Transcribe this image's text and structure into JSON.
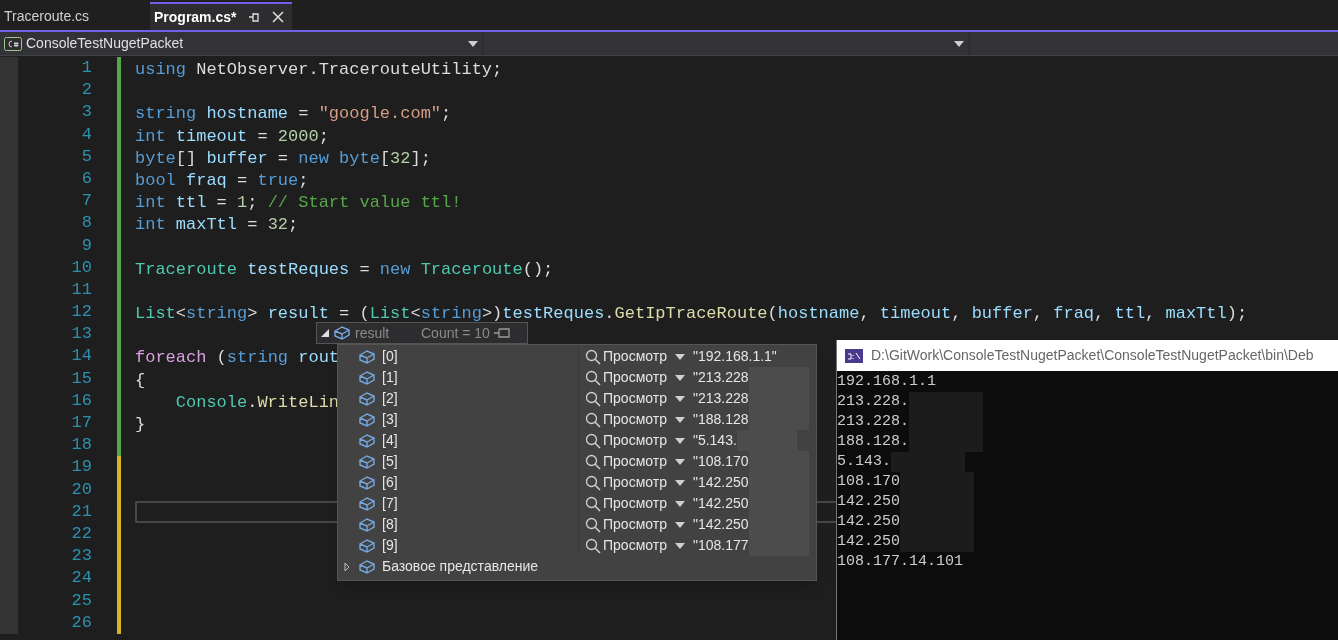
{
  "tabs": [
    {
      "label": "Traceroute.cs",
      "selected": false
    },
    {
      "label": "Program.cs*",
      "selected": true
    }
  ],
  "nav_bar": {
    "project": "ConsoleTestNugetPacket"
  },
  "editor": {
    "lines": [
      {
        "number": "1",
        "modified": false,
        "tokens": [
          {
            "text": "using ",
            "kind": "keyword"
          },
          {
            "text": "NetObserver.TracerouteUtility;",
            "kind": "plain"
          }
        ]
      },
      {
        "number": "2",
        "modified": false
      },
      {
        "number": "3",
        "modified": false,
        "tokens": [
          {
            "text": "string ",
            "kind": "keyword"
          },
          {
            "text": "hostname",
            "kind": "var"
          },
          {
            "text": " = ",
            "kind": "plain"
          },
          {
            "text": "\"google.com\"",
            "kind": "string"
          },
          {
            "text": ";",
            "kind": "plain"
          }
        ]
      },
      {
        "number": "4",
        "modified": false,
        "tokens": [
          {
            "text": "int ",
            "kind": "keyword"
          },
          {
            "text": "timeout",
            "kind": "var"
          },
          {
            "text": " = ",
            "kind": "plain"
          },
          {
            "text": "2000",
            "kind": "number"
          },
          {
            "text": ";",
            "kind": "plain"
          }
        ]
      },
      {
        "number": "5",
        "modified": false,
        "tokens": [
          {
            "text": "byte",
            "kind": "keyword"
          },
          {
            "text": "[] ",
            "kind": "plain"
          },
          {
            "text": "buffer",
            "kind": "var"
          },
          {
            "text": " = ",
            "kind": "plain"
          },
          {
            "text": "new ",
            "kind": "keyword"
          },
          {
            "text": "byte",
            "kind": "keyword"
          },
          {
            "text": "[",
            "kind": "plain"
          },
          {
            "text": "32",
            "kind": "number"
          },
          {
            "text": "];",
            "kind": "plain"
          }
        ]
      },
      {
        "number": "6",
        "modified": false,
        "tokens": [
          {
            "text": "bool ",
            "kind": "keyword"
          },
          {
            "text": "fraq",
            "kind": "var"
          },
          {
            "text": " = ",
            "kind": "plain"
          },
          {
            "text": "true",
            "kind": "keyword"
          },
          {
            "text": ";",
            "kind": "plain"
          }
        ]
      },
      {
        "number": "7",
        "modified": false,
        "tokens": [
          {
            "text": "int ",
            "kind": "keyword"
          },
          {
            "text": "ttl",
            "kind": "var"
          },
          {
            "text": " = ",
            "kind": "plain"
          },
          {
            "text": "1",
            "kind": "number"
          },
          {
            "text": "; ",
            "kind": "plain"
          },
          {
            "text": "// Start value ttl!",
            "kind": "comment"
          }
        ]
      },
      {
        "number": "8",
        "modified": false,
        "tokens": [
          {
            "text": "int ",
            "kind": "keyword"
          },
          {
            "text": "maxTtl",
            "kind": "var"
          },
          {
            "text": " = ",
            "kind": "plain"
          },
          {
            "text": "32",
            "kind": "number"
          },
          {
            "text": ";",
            "kind": "plain"
          }
        ]
      },
      {
        "number": "9",
        "modified": false
      },
      {
        "number": "10",
        "modified": false,
        "tokens": [
          {
            "text": "Traceroute ",
            "kind": "type"
          },
          {
            "text": "testReques",
            "kind": "var"
          },
          {
            "text": " = ",
            "kind": "plain"
          },
          {
            "text": "new ",
            "kind": "keyword"
          },
          {
            "text": "Traceroute",
            "kind": "type"
          },
          {
            "text": "();",
            "kind": "plain"
          }
        ]
      },
      {
        "number": "11",
        "modified": false
      },
      {
        "number": "12",
        "modified": false,
        "tokens": [
          {
            "text": "List",
            "kind": "type"
          },
          {
            "text": "<",
            "kind": "plain"
          },
          {
            "text": "string",
            "kind": "keyword"
          },
          {
            "text": "> ",
            "kind": "plain"
          },
          {
            "text": "result",
            "kind": "var"
          },
          {
            "text": " = (",
            "kind": "plain"
          },
          {
            "text": "List",
            "kind": "type"
          },
          {
            "text": "<",
            "kind": "plain"
          },
          {
            "text": "string",
            "kind": "keyword"
          },
          {
            "text": ">)",
            "kind": "plain"
          },
          {
            "text": "testReques",
            "kind": "var"
          },
          {
            "text": ".",
            "kind": "plain"
          },
          {
            "text": "GetIpTraceRoute",
            "kind": "method"
          },
          {
            "text": "(",
            "kind": "plain"
          },
          {
            "text": "hostname",
            "kind": "var"
          },
          {
            "text": ", ",
            "kind": "plain"
          },
          {
            "text": "timeout",
            "kind": "var"
          },
          {
            "text": ", ",
            "kind": "plain"
          },
          {
            "text": "buffer",
            "kind": "var"
          },
          {
            "text": ", ",
            "kind": "plain"
          },
          {
            "text": "fraq",
            "kind": "var"
          },
          {
            "text": ", ",
            "kind": "plain"
          },
          {
            "text": "ttl",
            "kind": "var"
          },
          {
            "text": ", ",
            "kind": "plain"
          },
          {
            "text": "maxTtl",
            "kind": "var"
          },
          {
            "text": ");",
            "kind": "plain"
          }
        ]
      },
      {
        "number": "13",
        "modified": false
      },
      {
        "number": "14",
        "modified": false,
        "tokens": [
          {
            "text": "foreach",
            "kind": "control"
          },
          {
            "text": " (",
            "kind": "plain"
          },
          {
            "text": "string ",
            "kind": "keyword"
          },
          {
            "text": "rout",
            "kind": "var"
          }
        ]
      },
      {
        "number": "15",
        "modified": false,
        "tokens": [
          {
            "text": "{",
            "kind": "plain"
          }
        ]
      },
      {
        "number": "16",
        "modified": false,
        "tokens": [
          {
            "text": "    Console",
            "kind": "type"
          },
          {
            "text": ".",
            "kind": "plain"
          },
          {
            "text": "WriteLin",
            "kind": "method"
          }
        ]
      },
      {
        "number": "17",
        "modified": false,
        "tokens": [
          {
            "text": "}",
            "kind": "plain"
          }
        ]
      },
      {
        "number": "18",
        "modified": false
      },
      {
        "number": "19",
        "modified": true
      },
      {
        "number": "20",
        "modified": true
      },
      {
        "number": "21",
        "modified": true,
        "current": true
      },
      {
        "number": "22",
        "modified": true
      },
      {
        "number": "23",
        "modified": true
      },
      {
        "number": "24",
        "modified": true
      },
      {
        "number": "25",
        "modified": true
      },
      {
        "number": "26",
        "modified": true
      }
    ]
  },
  "datatip": {
    "name": "result",
    "count": "Count = 10",
    "items": [
      {
        "index": "[0]",
        "viewer": "Просмотр",
        "value": "\"192.168.1.1\"",
        "redacted": false
      },
      {
        "index": "[1]",
        "viewer": "Просмотр",
        "value": "\"213.228",
        "redacted": true
      },
      {
        "index": "[2]",
        "viewer": "Просмотр",
        "value": "\"213.228",
        "redacted": true
      },
      {
        "index": "[3]",
        "viewer": "Просмотр",
        "value": "\"188.128",
        "redacted": true
      },
      {
        "index": "[4]",
        "viewer": "Просмотр",
        "value": "\"5.143.",
        "redacted": true
      },
      {
        "index": "[5]",
        "viewer": "Просмотр",
        "value": "\"108.170",
        "redacted": true
      },
      {
        "index": "[6]",
        "viewer": "Просмотр",
        "value": "\"142.250",
        "redacted": true
      },
      {
        "index": "[7]",
        "viewer": "Просмотр",
        "value": "\"142.250",
        "redacted": true
      },
      {
        "index": "[8]",
        "viewer": "Просмотр",
        "value": "\"142.250",
        "redacted": true
      },
      {
        "index": "[9]",
        "viewer": "Просмотр",
        "value": "\"108.177",
        "redacted": true
      }
    ],
    "base": {
      "label": "Базовое представление",
      "expanded": false
    }
  },
  "console": {
    "title": "D:\\GitWork\\ConsoleTestNugetPacket\\ConsoleTestNugetPacket\\bin\\Deb",
    "lines": [
      {
        "text": "192.168.1.1",
        "redacted": false
      },
      {
        "text": "213.228.",
        "redacted": true
      },
      {
        "text": "213.228.",
        "redacted": true
      },
      {
        "text": "188.128.",
        "redacted": true
      },
      {
        "text": "5.143.",
        "redacted": true
      },
      {
        "text": "108.170",
        "redacted": true
      },
      {
        "text": "142.250",
        "redacted": true
      },
      {
        "text": "142.250",
        "redacted": true
      },
      {
        "text": "142.250",
        "redacted": true
      },
      {
        "text": "108.177.14.101",
        "redacted": false
      }
    ]
  }
}
